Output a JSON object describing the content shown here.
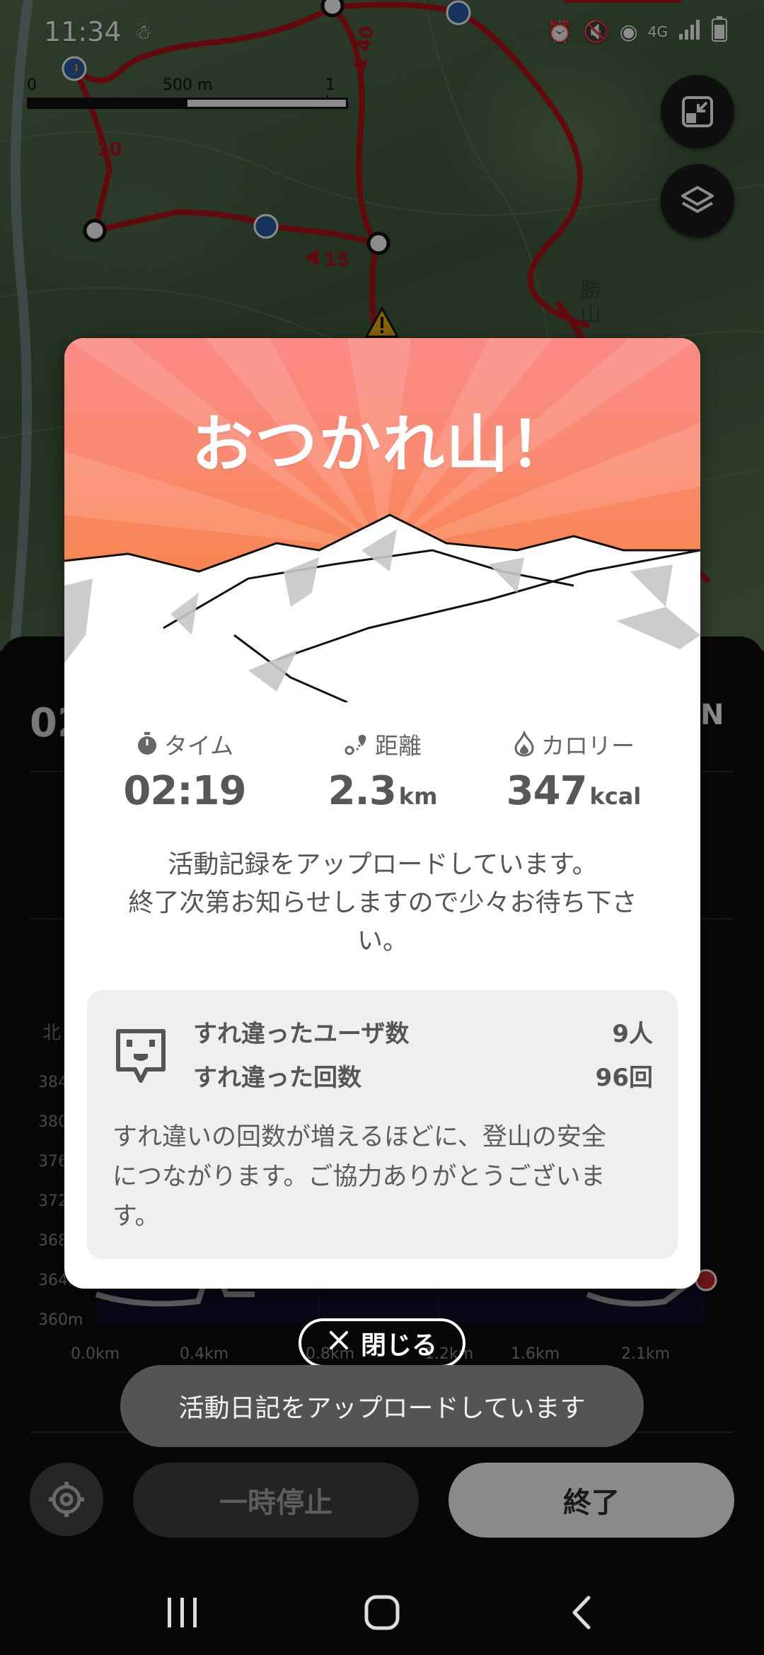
{
  "status_bar": {
    "time": "11:34",
    "network": "4G"
  },
  "map": {
    "scale_labels": [
      "0",
      "500 m",
      "1 km"
    ],
    "route_markers": [
      "10",
      "15",
      "40"
    ],
    "buttons": [
      "fit-route",
      "layers"
    ]
  },
  "panel": {
    "distance_prefix": "02",
    "north_label": "N",
    "side_label": "北",
    "elevation_ticks": [
      "384",
      "380",
      "376",
      "372",
      "368",
      "364m",
      "360m"
    ],
    "distance_ticks": [
      "0.0km",
      "0.4km",
      "0.8km",
      "1.2km",
      "1.6km",
      "2.1km"
    ]
  },
  "dialog": {
    "title": "おつかれ山！",
    "stats": [
      {
        "label": "タイム",
        "value": "02:19",
        "unit": "",
        "icon": "stopwatch-icon"
      },
      {
        "label": "距離",
        "value": "2.3",
        "unit": "km",
        "icon": "route-icon"
      },
      {
        "label": "カロリー",
        "value": "347",
        "unit": "kcal",
        "icon": "flame-icon"
      }
    ],
    "upload_message_line1": "活動記録をアップロードしています。",
    "upload_message_line2": "終了次第お知らせしますので少々お待ち下さ",
    "upload_message_line3": "い。",
    "passing": {
      "users_label": "すれ違ったユーザ数",
      "users_value": "9人",
      "count_label": "すれ違った回数",
      "count_value": "96回",
      "note_line1": "すれ違いの回数が増えるほどに、登山の安全",
      "note_line2": "につながります。ご協力ありがとうございま",
      "note_line3": "す。"
    }
  },
  "close_button": {
    "label": "閉じる"
  },
  "toast": {
    "text": "活動日記をアップロードしています"
  },
  "controls": {
    "pause_label": "一時停止",
    "end_label": "終了"
  },
  "colors": {
    "route": "#b3121b",
    "hero_top": "#fb8a86",
    "hero_bottom": "#f58b40"
  }
}
